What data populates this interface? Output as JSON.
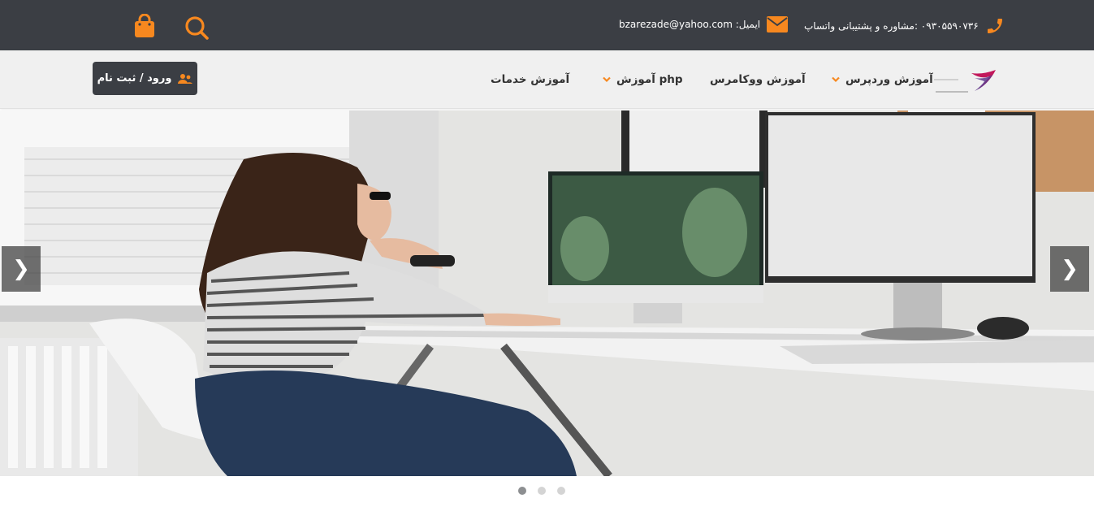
{
  "topbar": {
    "phone": "۰۹۳۰۵۵۹۰۷۳۶ :مشاوره و پشتیبانی واتساپ",
    "email_label": "ایمیل: bzarezade@yahoo.com",
    "icons": [
      "phone-icon",
      "mail-icon",
      "search-icon",
      "shopping-bag-icon"
    ],
    "accent": "#f7881f",
    "background": "#3b3e44"
  },
  "nav": {
    "items": [
      {
        "label": "آموزش وردپرس",
        "has_dropdown": true
      },
      {
        "label": "آموزش ووکامرس",
        "has_dropdown": false
      },
      {
        "label": "php آموزش",
        "has_dropdown": true
      },
      {
        "label": "آموزش خدمات",
        "has_dropdown": false
      }
    ],
    "login_label": "ورود / ثبت نام"
  },
  "slider": {
    "prev_label": "❮",
    "next_label": "❯",
    "slide_count": 3,
    "active_slide": 1
  }
}
